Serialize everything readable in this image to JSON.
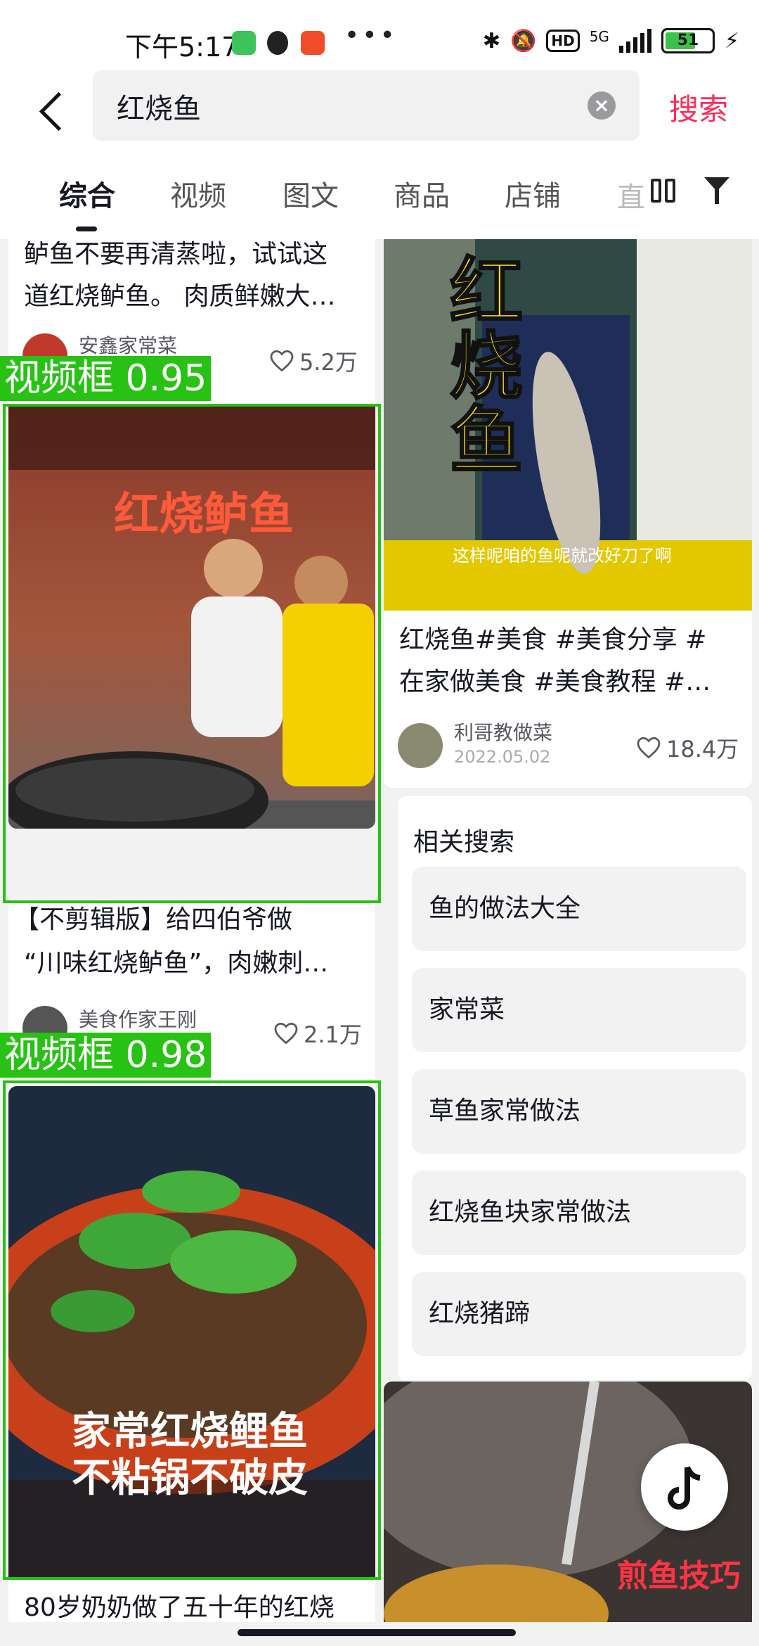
{
  "status_bar": {
    "time": "下午5:17",
    "dots": "•••",
    "network": "5G",
    "battery": "51"
  },
  "search": {
    "query": "红烧鱼",
    "clear_icon": "clear-icon",
    "button": "搜索"
  },
  "tabs": [
    {
      "label": "综合",
      "active": true
    },
    {
      "label": "视频",
      "active": false
    },
    {
      "label": "图文",
      "active": false
    },
    {
      "label": "商品",
      "active": false
    },
    {
      "label": "店铺",
      "active": false
    },
    {
      "label": "直",
      "active": false
    }
  ],
  "left_column": {
    "card1": {
      "title_line1": "鲈鱼不要再清蒸啦，试试这",
      "title_line2": "道红烧鲈鱼。 肉质鲜嫩大…",
      "author": "安鑫家常菜",
      "likes": "5.2万"
    },
    "detection1": {
      "label": "视频框 0.95"
    },
    "card2": {
      "thumb_text": "红烧鲈鱼",
      "title_line1": "【不剪辑版】给四伯爷做",
      "title_line2": "“川味红烧鲈鱼”，肉嫩刺…",
      "author": "美食作家王刚",
      "likes": "2.1万"
    },
    "detection2": {
      "label": "视频框 0.98"
    },
    "card3": {
      "thumb_line1": "家常红烧鲤鱼",
      "thumb_line2": "不粘锅不破皮",
      "title_line1": "80岁奶奶做了五十年的红烧"
    }
  },
  "right_column": {
    "card1": {
      "thumb_big_text": [
        "红",
        "烧",
        "鱼"
      ],
      "thumb_caption": "这样呢咱的鱼呢就改好刀了啊",
      "title_line1": "红烧鱼#美食 #美食分享 #",
      "title_line2": "在家做美食 #美食教程 #…",
      "author": "利哥教做菜",
      "date": "2022.05.02",
      "likes": "18.4万"
    },
    "related": {
      "title": "相关搜索",
      "items": [
        "鱼的做法大全",
        "家常菜",
        "草鱼家常做法",
        "红烧鱼块家常做法",
        "红烧猪蹄"
      ]
    },
    "card2": {
      "thumb_text": "煎鱼技巧"
    }
  },
  "colors": {
    "accent": "#fe2c55",
    "detection": "#27c214"
  }
}
